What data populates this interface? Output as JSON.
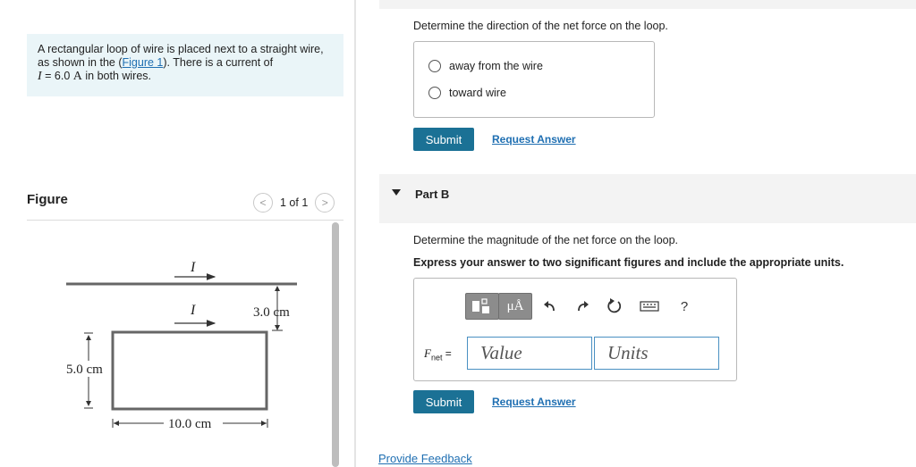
{
  "problem": {
    "text_before_link": "A rectangular loop of wire is placed next to a straight wire, as shown in the (",
    "link_text": "Figure 1",
    "text_after_link": "). There is a current of",
    "current_symbol": "I",
    "current_eq": " = 6.0 ",
    "current_unit": "A",
    "current_tail": " in both wires."
  },
  "figure": {
    "title": "Figure",
    "pager": "1 of 1",
    "prev_glyph": "<",
    "next_glyph": ">",
    "label_I_top": "I",
    "label_I_loop": "I",
    "dim_gap": "3.0 cm",
    "dim_height": "5.0 cm",
    "dim_width": "10.0 cm"
  },
  "partA": {
    "question": "Determine the direction of the net force on the loop.",
    "options": [
      "away from the wire",
      "toward wire"
    ],
    "submit": "Submit",
    "request_answer": "Request Answer"
  },
  "partB": {
    "title": "Part B",
    "question": "Determine the magnitude of the net force on the loop.",
    "instruction": "Express your answer to two significant figures and include the appropriate units.",
    "toolbar": {
      "units_btn": "μÅ",
      "undo_icon": "undo-icon",
      "redo_icon": "redo-icon",
      "reset_icon": "reset-icon",
      "keyboard_icon": "keyboard-icon",
      "help": "?"
    },
    "fnet_symbol": "F",
    "fnet_sub": "net",
    "fnet_eq": " =",
    "value_placeholder": "Value",
    "units_placeholder": "Units",
    "submit": "Submit",
    "request_answer": "Request Answer"
  },
  "feedback": "Provide Feedback"
}
